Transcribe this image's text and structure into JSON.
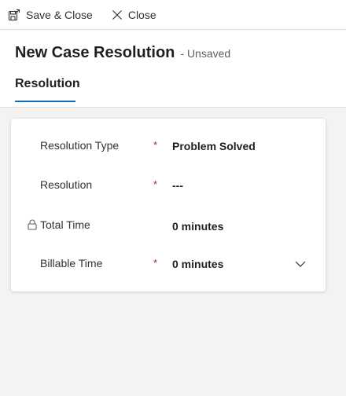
{
  "toolbar": {
    "save_close_label": "Save & Close",
    "close_label": "Close"
  },
  "header": {
    "title": "New Case Resolution",
    "status": "- Unsaved",
    "tabs": [
      {
        "label": "Resolution",
        "selected": true
      }
    ]
  },
  "form": {
    "fields": [
      {
        "label": "Resolution Type",
        "required": true,
        "value": "Problem Solved",
        "locked": false
      },
      {
        "label": "Resolution",
        "required": true,
        "value": "---",
        "locked": false
      },
      {
        "label": "Total Time",
        "required": false,
        "value": "0 minutes",
        "locked": true
      },
      {
        "label": "Billable Time",
        "required": true,
        "value": "0 minutes",
        "locked": false,
        "dropdown": true
      }
    ],
    "required_marker": "*"
  },
  "colors": {
    "accent": "#0f6cbd",
    "required": "#a4262c",
    "page_bg": "#f4f3f2"
  },
  "icons": {
    "save_close": "save-close-icon",
    "close": "close-icon",
    "lock": "lock-icon",
    "dropdown": "chevron-down-icon"
  }
}
